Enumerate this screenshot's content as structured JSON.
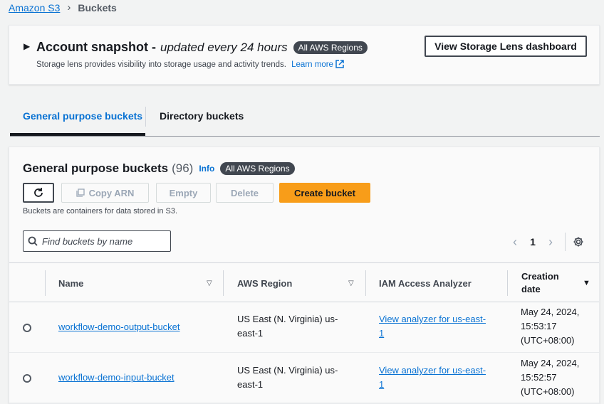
{
  "breadcrumb": {
    "root": "Amazon S3",
    "separator": "›",
    "current": "Buckets"
  },
  "snapshot": {
    "title": "Account snapshot -",
    "subtitle": "updated every 24 hours",
    "badge": "All AWS Regions",
    "description": "Storage lens provides visibility into storage usage and activity trends.",
    "learn_more": "Learn more",
    "dashboard_button": "View Storage Lens dashboard"
  },
  "tabs": {
    "general": "General purpose buckets",
    "directory": "Directory buckets"
  },
  "panel": {
    "title": "General purpose buckets",
    "count": "(96)",
    "info": "Info",
    "badge": "All AWS Regions",
    "buttons": {
      "copy_arn": "Copy ARN",
      "empty": "Empty",
      "delete": "Delete",
      "create": "Create bucket"
    },
    "subtitle": "Buckets are containers for data stored in S3.",
    "search_placeholder": "Find buckets by name",
    "page": "1"
  },
  "table": {
    "headers": {
      "name": "Name",
      "region": "AWS Region",
      "iam": "IAM Access Analyzer",
      "created": "Creation date"
    },
    "rows": [
      {
        "name": "workflow-demo-output-bucket",
        "region_l1": "US East (N. Virginia) us-",
        "region_l2": "east-1",
        "iam_l1": "View analyzer for us-east-",
        "iam_l2": "1",
        "date_l1": "May 24, 2024,",
        "date_l2": "15:53:17",
        "date_l3": "(UTC+08:00)"
      },
      {
        "name": "workflow-demo-input-bucket",
        "region_l1": "US East (N. Virginia) us-",
        "region_l2": "east-1",
        "iam_l1": "View analyzer for us-east-",
        "iam_l2": "1",
        "date_l1": "May 24, 2024,",
        "date_l2": "15:52:57",
        "date_l3": "(UTC+08:00)"
      }
    ]
  },
  "colors": {
    "link": "#0972d3",
    "primary_button": "#f89d19",
    "badge": "#414750"
  },
  "icons": {
    "refresh": "refresh-icon",
    "copy": "copy-icon",
    "search": "search-icon",
    "settings": "gear-icon",
    "external": "external-link-icon"
  }
}
